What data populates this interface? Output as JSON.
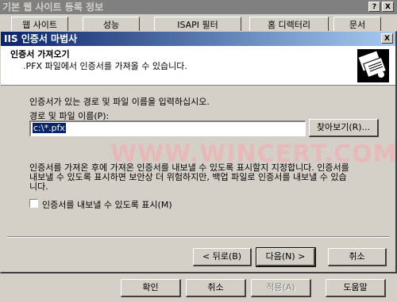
{
  "background_dialog": {
    "title": "기본 웹 사이트 등록 정보",
    "help_button": "?",
    "close_button": "X",
    "tabs": [
      "웹 사이트",
      "성능",
      "ISAPI 필터",
      "홈 디렉터리",
      "문서"
    ],
    "buttons": {
      "ok": "확인",
      "cancel": "취소",
      "apply": "적용(A)",
      "help": "도움말"
    }
  },
  "wizard": {
    "title": "IIS 인증서 마법사",
    "close_button": "X",
    "header_title": "인증서 가져오기",
    "header_subtitle": ".PFX 파일에서 인증서를 가져올 수 있습니다.",
    "instruction": "인증서가 있는 경로 및 파일 이름을 입력하십시오.",
    "path_label": "경로 및 파일 이름(P):",
    "path_value": "c:\\*.pfx",
    "browse_button": "찾아보기(R)...",
    "description_line1": "인증서를 가져온 후에 가져온 인증서를 내보낼 수 있도록 표시할지 지정합니다. 인증서를",
    "description_line2": "내보낼 수 있도록 표시하면 보안상 더 위험하지만, 백업 파일로 인증서를 내보낼 수 있습",
    "description_line3": "니다.",
    "checkbox_label": "인증서를 내보낼 수 있도록 표시(M)",
    "checkbox_checked": false,
    "back_button": "< 뒤로(B)",
    "next_button": "다음(N) >",
    "cancel_button": "취소"
  },
  "watermark": "WWW.WINCERT.COM",
  "colors": {
    "titlebar_start": "#0a246a",
    "titlebar_end": "#a6caf0",
    "inactive_title": "#808080",
    "face": "#d4d0c8",
    "watermark": "#e7b9b9"
  }
}
